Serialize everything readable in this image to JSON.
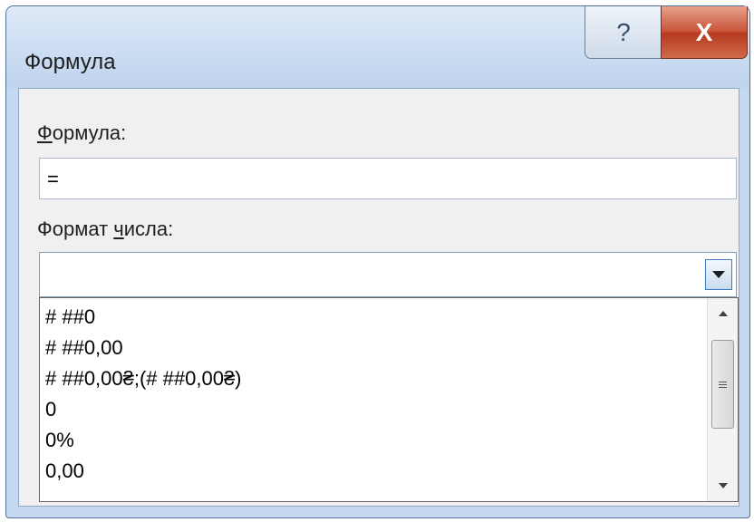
{
  "window": {
    "title": "Формула",
    "help_glyph": "?",
    "close_glyph": "X"
  },
  "formula": {
    "label_accel": "Ф",
    "label_rest": "ормула:",
    "value": "="
  },
  "number_format": {
    "label_before": "Формат ",
    "label_accel": "ч",
    "label_after": "исла:",
    "selected_value": "",
    "options": [
      "# ##0",
      "# ##0,00",
      "# ##0,00₴;(# ##0,00₴)",
      "0",
      "0%",
      "0,00"
    ]
  },
  "icons": {
    "help": "help-icon",
    "close": "close-icon",
    "dropdown": "chevron-down-icon",
    "scroll_up": "scroll-up-icon",
    "scroll_down": "scroll-down-icon",
    "scroll_grip": "grip-icon"
  },
  "colors": {
    "frame": "#c5d8ef",
    "close_button": "#c9553a",
    "dropdown_accent": "#3d7bbf"
  }
}
